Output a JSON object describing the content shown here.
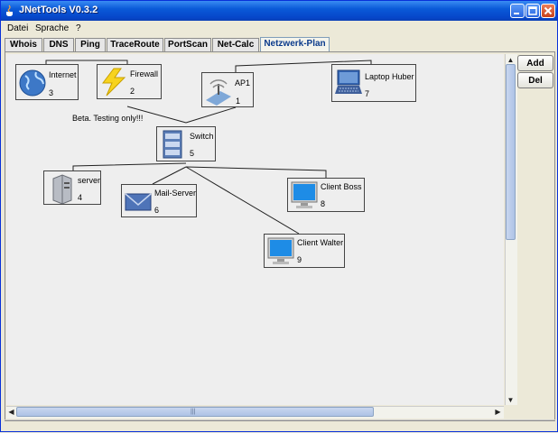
{
  "window": {
    "title": "JNetTools V0.3.2"
  },
  "menu": [
    "Datei",
    "Sprache",
    "?"
  ],
  "tabs": [
    {
      "label": "Whois",
      "active": false
    },
    {
      "label": "DNS",
      "active": false
    },
    {
      "label": "Ping",
      "active": false
    },
    {
      "label": "TraceRoute",
      "active": false
    },
    {
      "label": "PortScan",
      "active": false
    },
    {
      "label": "Net-Calc",
      "active": false
    },
    {
      "label": "Netzwerk-Plan",
      "active": true
    }
  ],
  "buttons": {
    "add": "Add",
    "del": "Del"
  },
  "canvas_note": "Beta. Testing only!!!",
  "nodes": [
    {
      "id": "3",
      "label": "Internet",
      "icon": "globe-icon"
    },
    {
      "id": "2",
      "label": "Firewall",
      "icon": "lightning-icon"
    },
    {
      "id": "1",
      "label": "AP1",
      "icon": "wireless-ap-icon"
    },
    {
      "id": "7",
      "label": "Laptop Huber",
      "icon": "laptop-icon"
    },
    {
      "id": "5",
      "label": "Switch",
      "icon": "switch-icon"
    },
    {
      "id": "4",
      "label": "server",
      "icon": "server-icon"
    },
    {
      "id": "6",
      "label": "Mail-Server",
      "icon": "mail-icon"
    },
    {
      "id": "8",
      "label": "Client Boss",
      "icon": "monitor-icon"
    },
    {
      "id": "9",
      "label": "Client Walter",
      "icon": "monitor-icon"
    }
  ],
  "scrollbar_grip": "|||",
  "colors": {
    "titlebar": "#0A5AD8",
    "active_tab_text": "#0B3B8C",
    "window_bg": "#ECE9D8"
  }
}
